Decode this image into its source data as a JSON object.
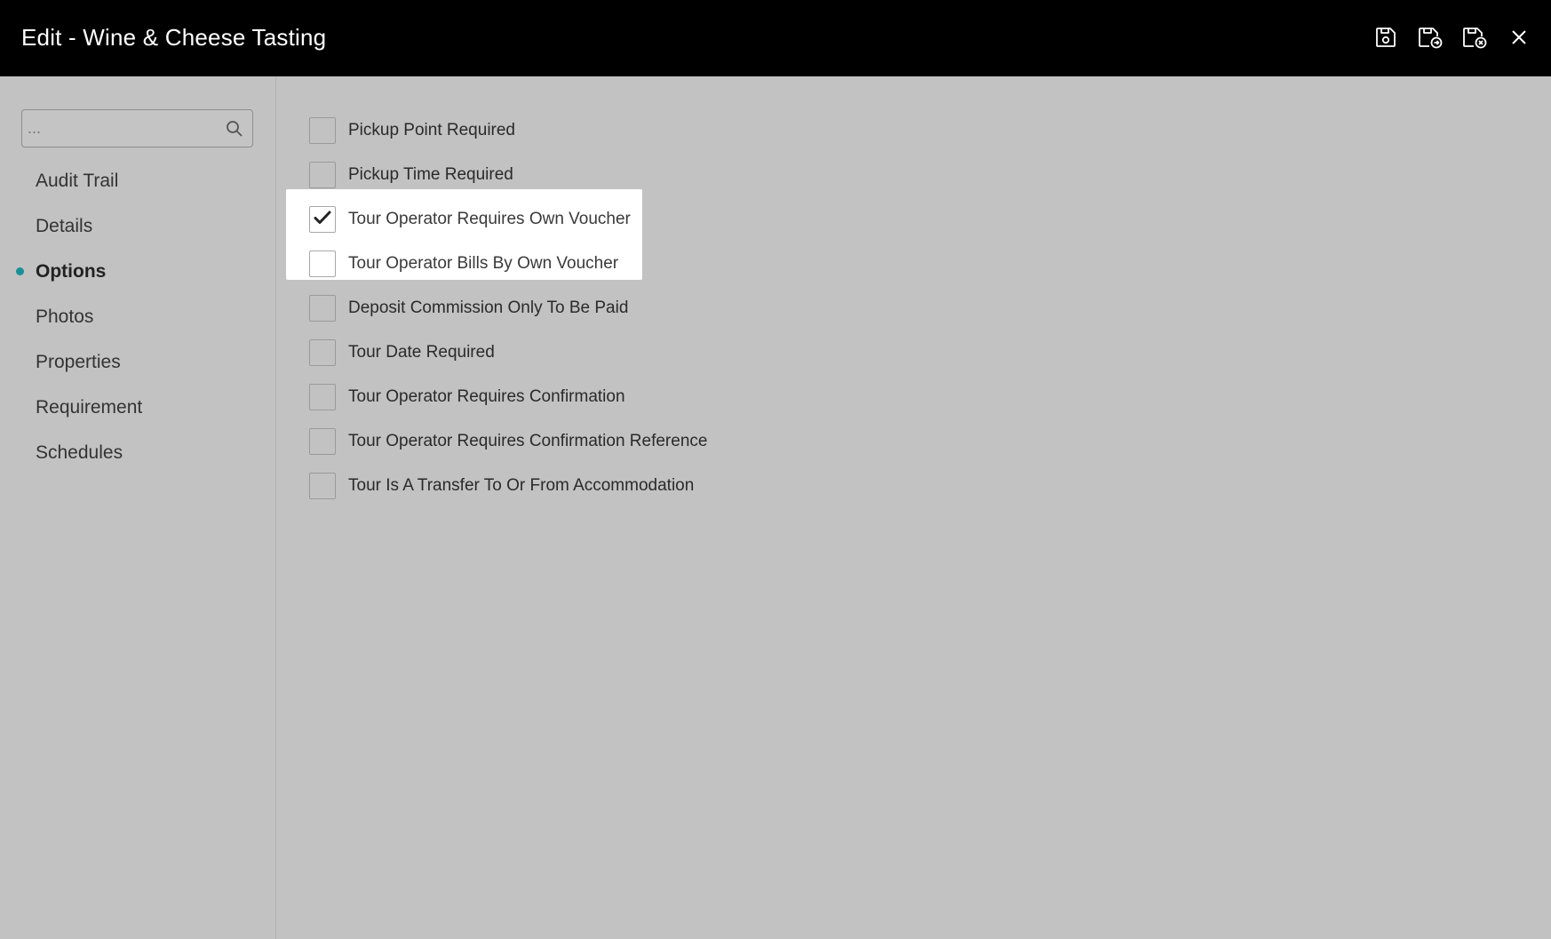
{
  "window": {
    "title": "Edit - Wine & Cheese Tasting",
    "actions": [
      {
        "name": "save-icon",
        "label": "Save"
      },
      {
        "name": "save-and-open-icon",
        "label": "Save and Open"
      },
      {
        "name": "save-and-close-icon",
        "label": "Save and Close"
      },
      {
        "name": "close-icon",
        "label": "Close"
      }
    ]
  },
  "sidebar": {
    "search": {
      "placeholder": "...",
      "value": ""
    },
    "items": [
      {
        "label": "Audit Trail",
        "active": false
      },
      {
        "label": "Details",
        "active": false
      },
      {
        "label": "Options",
        "active": true
      },
      {
        "label": "Photos",
        "active": false
      },
      {
        "label": "Properties",
        "active": false
      },
      {
        "label": "Requirement",
        "active": false
      },
      {
        "label": "Schedules",
        "active": false
      }
    ]
  },
  "options": [
    {
      "label": "Pickup Point Required",
      "checked": false,
      "highlighted": false
    },
    {
      "label": "Pickup Time Required",
      "checked": false,
      "highlighted": false
    },
    {
      "label": "Tour Operator Requires Own Voucher",
      "checked": true,
      "highlighted": true
    },
    {
      "label": "Tour Operator Bills By Own Voucher",
      "checked": false,
      "highlighted": true
    },
    {
      "label": "Deposit Commission Only To Be Paid",
      "checked": false,
      "highlighted": false
    },
    {
      "label": "Tour Date Required",
      "checked": false,
      "highlighted": false
    },
    {
      "label": "Tour Operator Requires Confirmation",
      "checked": false,
      "highlighted": false
    },
    {
      "label": "Tour Operator Requires Confirmation Reference",
      "checked": false,
      "highlighted": false
    },
    {
      "label": "Tour Is A Transfer To Or From Accommodation",
      "checked": false,
      "highlighted": false
    }
  ],
  "colors": {
    "header_bg": "#000000",
    "content_bg": "#c2c2c2",
    "accent": "#1a8f96",
    "highlight": "#ffffff"
  }
}
